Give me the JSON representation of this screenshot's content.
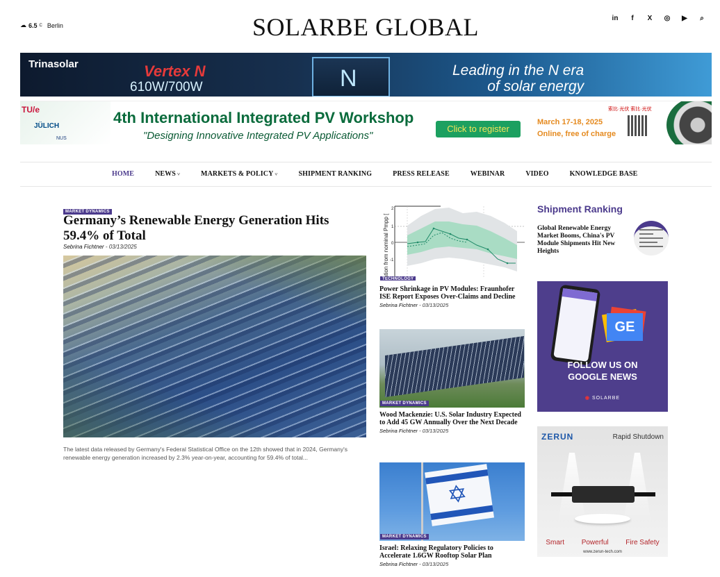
{
  "header": {
    "weather_temp": "6.5",
    "weather_unit": "C",
    "weather_city": "Berlin",
    "site_title": "SOLARBE GLOBAL",
    "socials": [
      "in",
      "f",
      "X",
      "◎",
      "▶",
      "⌕"
    ]
  },
  "banner_trina": {
    "brand": "Trinasolar",
    "product": "Vertex N",
    "watts": "610W/700W",
    "panel_letter": "N",
    "slogan_line1": "Leading in the N era",
    "slogan_line2": "of solar energy"
  },
  "banner_workshop": {
    "logo1": "TU/e",
    "logo2": "JÜLICH",
    "logo3": "NUS",
    "title": "4th International Integrated PV Workshop",
    "subtitle": "\"Designing Innovative Integrated PV Applications\"",
    "cta": "Click to register",
    "date_line1": "March 17-18, 2025",
    "date_line2": "Online, free of charge",
    "cn_logos": "索比·光伏   索比·光伏"
  },
  "nav": {
    "items": [
      {
        "label": "HOME",
        "dropdown": false,
        "active": true
      },
      {
        "label": "NEWS",
        "dropdown": true,
        "active": false
      },
      {
        "label": "MARKETS & POLICY",
        "dropdown": true,
        "active": false
      },
      {
        "label": "SHIPMENT RANKING",
        "dropdown": false,
        "active": false
      },
      {
        "label": "PRESS RELEASE",
        "dropdown": false,
        "active": false
      },
      {
        "label": "WEBINAR",
        "dropdown": false,
        "active": false
      },
      {
        "label": "VIDEO",
        "dropdown": false,
        "active": false
      },
      {
        "label": "KNOWLEDGE BASE",
        "dropdown": false,
        "active": false
      }
    ],
    "chevron": "˅"
  },
  "featured": {
    "tag": "MARKET DYNAMICS",
    "title": "Germany’s Renewable Energy Generation Hits 59.4% of Total",
    "author": "Sebrina Fichtner",
    "date": "03/13/2025",
    "excerpt": "The latest data released by Germany's Federal Statistical Office on the 12th showed that in 2024, Germany's renewable energy generation increased by 2.3% year-on-year, accounting for 59.4% of total..."
  },
  "mid_articles": [
    {
      "tag": "TECHNOLOGY",
      "title": "Power Shrinkage in PV Modules: Fraunhofer ISE Report Exposes Over-Claims and Decline",
      "author": "Sebrina Fichtner",
      "date": "03/13/2025",
      "chart_axis_label": "ation from nominal Pmpp [",
      "chart_ticks": [
        "2",
        "1",
        "0",
        "-1"
      ]
    },
    {
      "tag": "MARKET DYNAMICS",
      "title": "Wood Mackenzie: U.S. Solar Industry Expected to Add 45 GW Annually Over the Next Decade",
      "author": "Sebrina Fichtner",
      "date": "03/13/2025"
    },
    {
      "tag": "MARKET DYNAMICS",
      "title": "Israel: Relaxing Regulatory Policies to Accelerate 1.6GW Rooftop Solar Plan",
      "author": "Sebrina Fichtner",
      "date": "03/13/2025"
    }
  ],
  "sidebar": {
    "heading": "Shipment Ranking",
    "item_title": "Global Renewable Energy Market Booms, China's PV Module Shipments Hit New Heights"
  },
  "ad_google": {
    "badge": "GE",
    "follow_line1": "FOLLOW US ON",
    "follow_line2": "GOOGLE NEWS",
    "brand": "SOLARBE"
  },
  "ad_zerun": {
    "brand": "ZERUN",
    "headline": "Rapid Shutdown",
    "features": [
      "Smart",
      "Powerful",
      "Fire Safety"
    ],
    "url": "www.zerun-tech.com"
  },
  "colors": {
    "accent": "#4b3a8c",
    "tag_bg": "#4b3a8c",
    "workshop_green": "#0a6b3c"
  },
  "byline_sep": " - "
}
